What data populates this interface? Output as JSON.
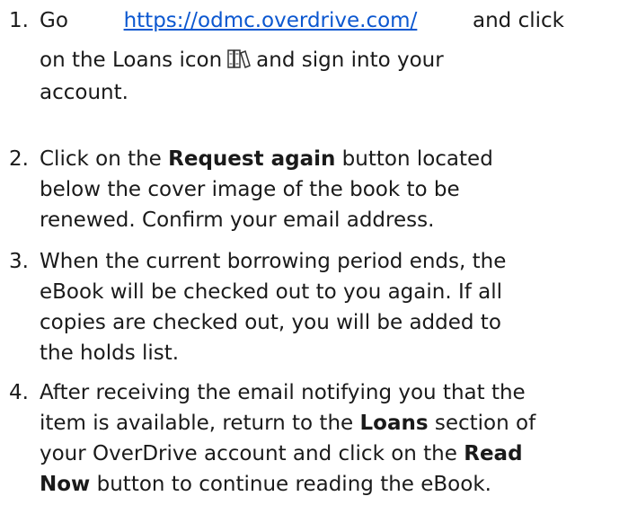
{
  "steps": [
    {
      "number": "1.",
      "link_before": "Go",
      "link_text": "https://odmc.overdrive.com/",
      "link_after": "and click",
      "line2_before": "on the Loans icon",
      "icon": "books-icon",
      "line2_after": "and sign into your",
      "line3": "account."
    },
    {
      "number": "2.",
      "pre": "Click on the",
      "bold": "Request again",
      "post": "button located",
      "line2": "below the cover image of the book to be",
      "line3": "renewed. Confirm your email address."
    },
    {
      "number": "3.",
      "line1": "When the current borrowing period ends, the",
      "line2": "eBook will be checked out to you again. If all",
      "line3": "copies are checked out, you will be added to",
      "line4": "the holds list."
    },
    {
      "number": "4.",
      "line1": "After receiving the email notifying you that the",
      "line2": "item is available, return to the",
      "line2_bold": "Loans",
      "line2_after": "section of",
      "line3": "your OverDrive account and click on the",
      "line3_bold": "Read",
      "line4_bold": "Now",
      "line4_after": "button to continue reading the eBook."
    }
  ]
}
